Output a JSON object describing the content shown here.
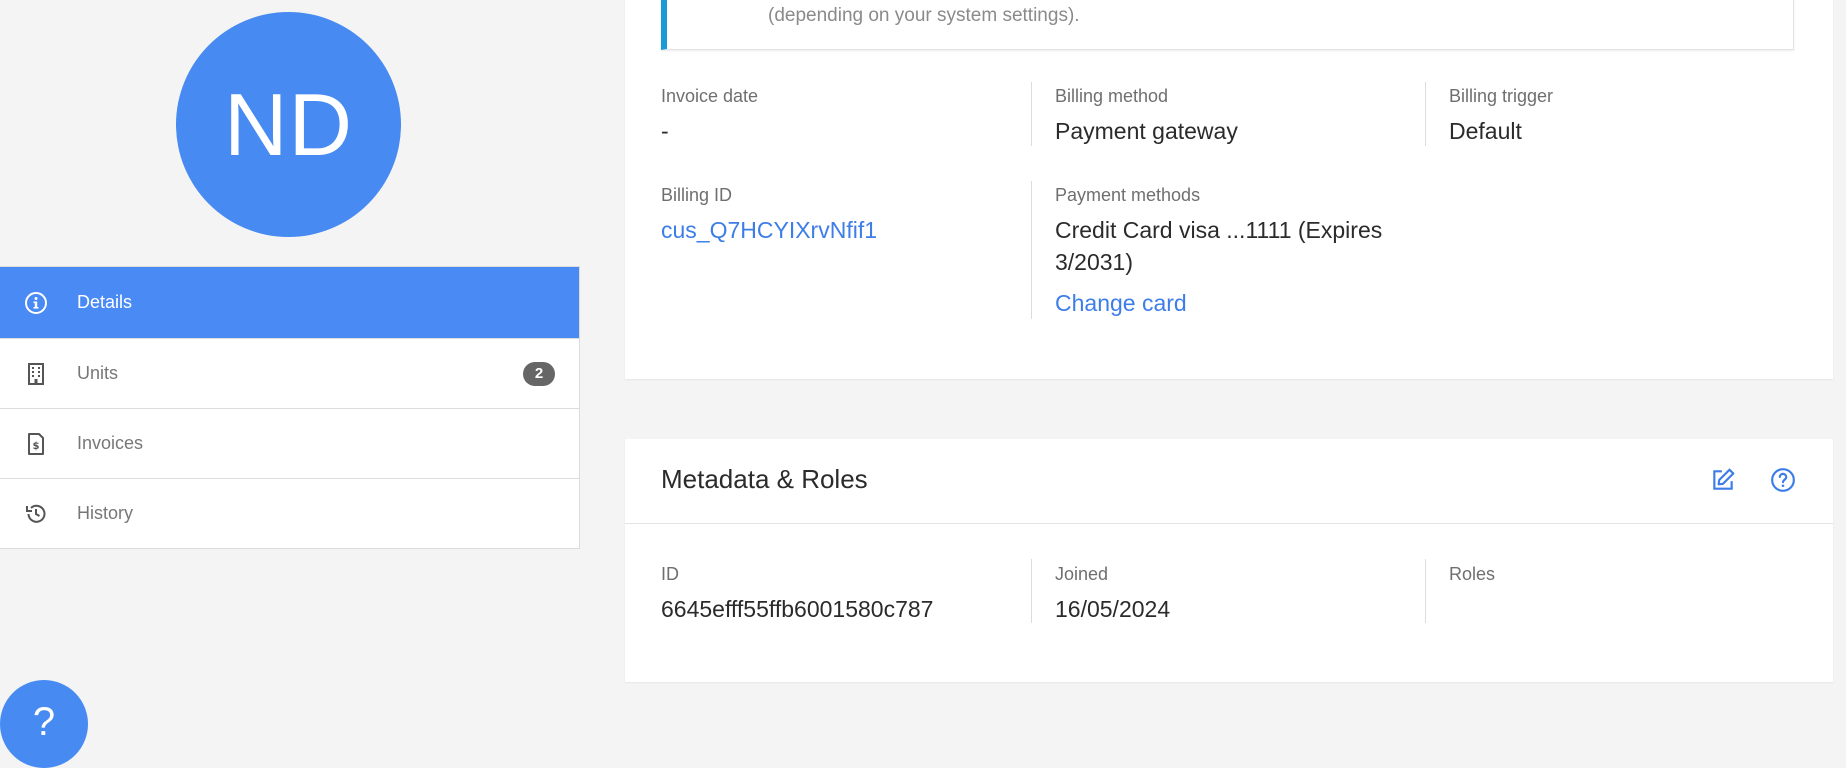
{
  "profile": {
    "initials": "ND",
    "avatar_color": "#468af2"
  },
  "nav": {
    "items": [
      {
        "label": "Details",
        "icon": "info-icon",
        "active": true
      },
      {
        "label": "Units",
        "icon": "building-icon",
        "badge": "2"
      },
      {
        "label": "Invoices",
        "icon": "invoice-icon"
      },
      {
        "label": "History",
        "icon": "history-icon"
      }
    ]
  },
  "billing": {
    "notice_text": "(depending on your system settings).",
    "invoice_date": {
      "label": "Invoice date",
      "value": "-"
    },
    "billing_method": {
      "label": "Billing method",
      "value": "Payment gateway"
    },
    "billing_trigger": {
      "label": "Billing trigger",
      "value": "Default"
    },
    "billing_id": {
      "label": "Billing ID",
      "value": "cus_Q7HCYIXrvNfif1"
    },
    "payment_methods": {
      "label": "Payment methods",
      "value_line1": "Credit Card visa ...1111 (Expires",
      "value_line2": "3/2031)",
      "change_label": "Change card"
    }
  },
  "metadata": {
    "title": "Metadata & Roles",
    "id": {
      "label": "ID",
      "value": "6645efff55ffb6001580c787"
    },
    "joined": {
      "label": "Joined",
      "value": "16/05/2024"
    },
    "roles": {
      "label": "Roles",
      "value": ""
    }
  },
  "help": {
    "symbol": "?"
  },
  "colors": {
    "accent": "#4a8af4",
    "link": "#3d7de8",
    "notice_border": "#1a9bd7",
    "badge": "#666666"
  }
}
